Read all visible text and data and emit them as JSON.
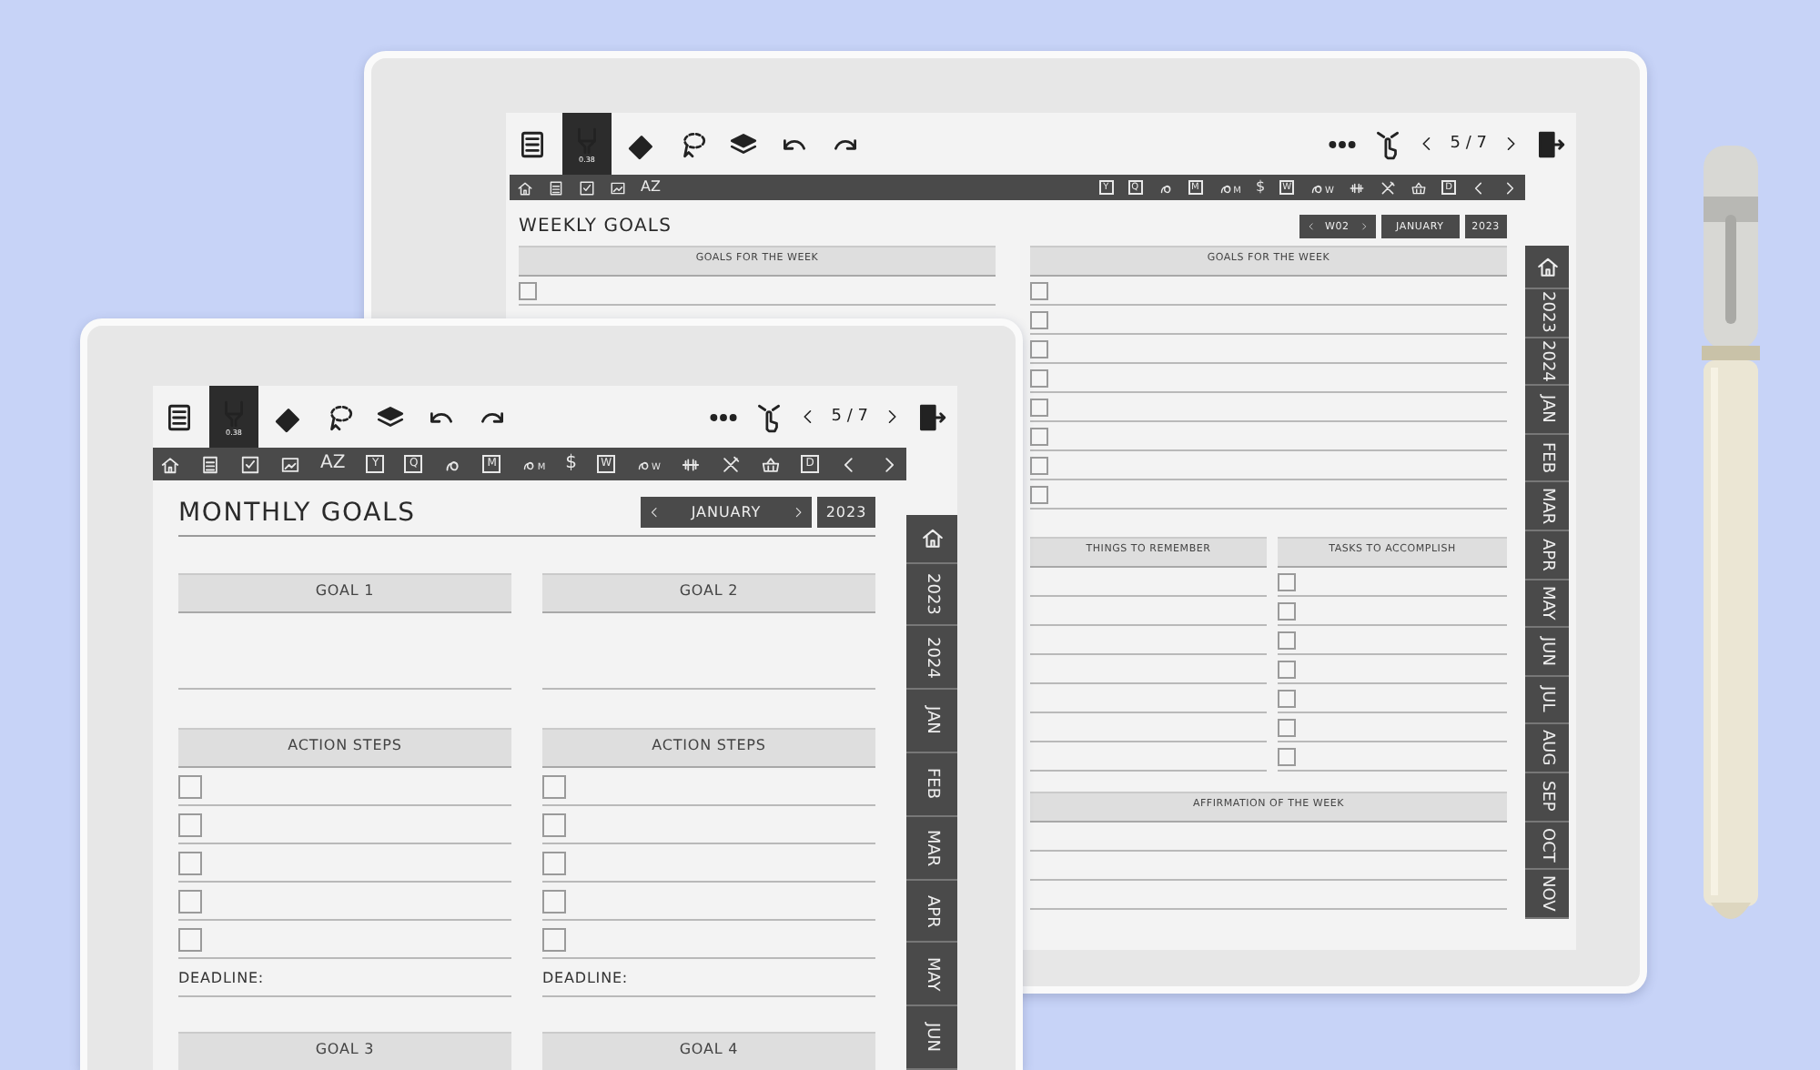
{
  "devices": [
    {
      "kind": "back",
      "tools": [
        {
          "kind": "menu",
          "selected": false
        },
        {
          "kind": "pen",
          "selected": true,
          "label": "0.38"
        },
        {
          "kind": "eraser",
          "selected": false
        },
        {
          "kind": "lasso",
          "selected": false
        },
        {
          "kind": "layers",
          "selected": false
        },
        {
          "kind": "undo",
          "selected": false
        },
        {
          "kind": "redo",
          "selected": false
        }
      ],
      "page": "5 / 7",
      "nav_left": [
        {
          "kind": "home"
        },
        {
          "kind": "notes"
        },
        {
          "kind": "check"
        },
        {
          "kind": "photo"
        },
        {
          "kind": "text",
          "label": "AZ"
        }
      ],
      "nav_right": [
        {
          "kind": "cal",
          "label": "Y"
        },
        {
          "kind": "cal",
          "label": "Q"
        },
        {
          "kind": "swirl"
        },
        {
          "kind": "cal",
          "label": "M"
        },
        {
          "kind": "swirl",
          "label": "M"
        },
        {
          "kind": "text",
          "label": "$"
        },
        {
          "kind": "cal",
          "label": "W"
        },
        {
          "kind": "swirl",
          "label": "W"
        },
        {
          "kind": "dumbbell"
        },
        {
          "kind": "tools"
        },
        {
          "kind": "basket"
        },
        {
          "kind": "cal",
          "label": "D"
        },
        {
          "kind": "prev"
        },
        {
          "kind": "next"
        }
      ],
      "title": "WEEKLY GOALS",
      "selectors": [
        {
          "label": "W02",
          "arrows": true
        },
        {
          "label": "JANUARY",
          "arrows": false
        },
        {
          "label": "2023",
          "arrows": false
        }
      ],
      "tabs": [
        {
          "kind": "home"
        },
        {
          "label": "2023"
        },
        {
          "label": "2024"
        },
        {
          "label": "JAN"
        },
        {
          "label": "FEB"
        },
        {
          "label": "MAR"
        },
        {
          "label": "APR"
        },
        {
          "label": "MAY"
        },
        {
          "label": "JUN"
        },
        {
          "label": "JUL"
        },
        {
          "label": "AUG"
        },
        {
          "label": "SEP"
        },
        {
          "label": "OCT"
        },
        {
          "label": "NOV"
        }
      ],
      "goal_columns": [
        {
          "header": "GOALS FOR THE WEEK",
          "items": [
            {
              "checked": false
            }
          ]
        },
        {
          "header": "GOALS FOR THE WEEK",
          "items": [
            {
              "checked": false
            },
            {
              "checked": false
            },
            {
              "checked": false
            },
            {
              "checked": false
            },
            {
              "checked": false
            },
            {
              "checked": false
            },
            {
              "checked": false
            },
            {
              "checked": false
            }
          ]
        }
      ],
      "remember": {
        "header": "THINGS TO REMEMBER"
      },
      "tasks": {
        "header": "TASKS TO ACCOMPLISH",
        "items": [
          {
            "checked": false
          },
          {
            "checked": false
          },
          {
            "checked": false
          },
          {
            "checked": false
          },
          {
            "checked": false
          },
          {
            "checked": false
          },
          {
            "checked": false
          }
        ]
      },
      "affirmation": {
        "header": "AFFIRMATION OF THE WEEK"
      }
    },
    {
      "kind": "front",
      "tools": [
        {
          "kind": "menu",
          "selected": false
        },
        {
          "kind": "pen",
          "selected": true,
          "label": "0.38"
        },
        {
          "kind": "eraser",
          "selected": false
        },
        {
          "kind": "lasso",
          "selected": false
        },
        {
          "kind": "layers",
          "selected": false
        },
        {
          "kind": "undo",
          "selected": false
        },
        {
          "kind": "redo",
          "selected": false
        }
      ],
      "page": "5 / 7",
      "nav_left": [
        {
          "kind": "home"
        },
        {
          "kind": "notes"
        },
        {
          "kind": "check"
        },
        {
          "kind": "photo"
        },
        {
          "kind": "text",
          "label": "AZ"
        }
      ],
      "nav_right": [
        {
          "kind": "cal",
          "label": "Y"
        },
        {
          "kind": "cal",
          "label": "Q"
        },
        {
          "kind": "swirl"
        },
        {
          "kind": "cal",
          "label": "M"
        },
        {
          "kind": "swirl",
          "label": "M"
        },
        {
          "kind": "text",
          "label": "$"
        },
        {
          "kind": "cal",
          "label": "W"
        },
        {
          "kind": "swirl",
          "label": "W"
        },
        {
          "kind": "dumbbell"
        },
        {
          "kind": "tools"
        },
        {
          "kind": "basket"
        },
        {
          "kind": "cal",
          "label": "D"
        },
        {
          "kind": "prev"
        },
        {
          "kind": "next"
        }
      ],
      "title": "MONTHLY GOALS",
      "selectors": [
        {
          "label": "JANUARY",
          "arrows": true
        },
        {
          "label": "2023",
          "arrows": false
        }
      ],
      "tabs": [
        {
          "kind": "home"
        },
        {
          "label": "2023"
        },
        {
          "label": "2024"
        },
        {
          "label": "JAN"
        },
        {
          "label": "FEB"
        },
        {
          "label": "MAR"
        },
        {
          "label": "APR"
        },
        {
          "label": "MAY"
        },
        {
          "label": "JUN"
        }
      ],
      "goals": [
        {
          "header": "GOAL 1",
          "steps_header": "ACTION STEPS",
          "steps": [
            {
              "checked": false
            },
            {
              "checked": false
            },
            {
              "checked": false
            },
            {
              "checked": false
            },
            {
              "checked": false
            }
          ],
          "deadline": "DEADLINE:"
        },
        {
          "header": "GOAL 2",
          "steps_header": "ACTION STEPS",
          "steps": [
            {
              "checked": false
            },
            {
              "checked": false
            },
            {
              "checked": false
            },
            {
              "checked": false
            },
            {
              "checked": false
            }
          ],
          "deadline": "DEADLINE:"
        }
      ],
      "more_goals": [
        {
          "header": "GOAL 3"
        },
        {
          "header": "GOAL 4"
        }
      ]
    }
  ]
}
